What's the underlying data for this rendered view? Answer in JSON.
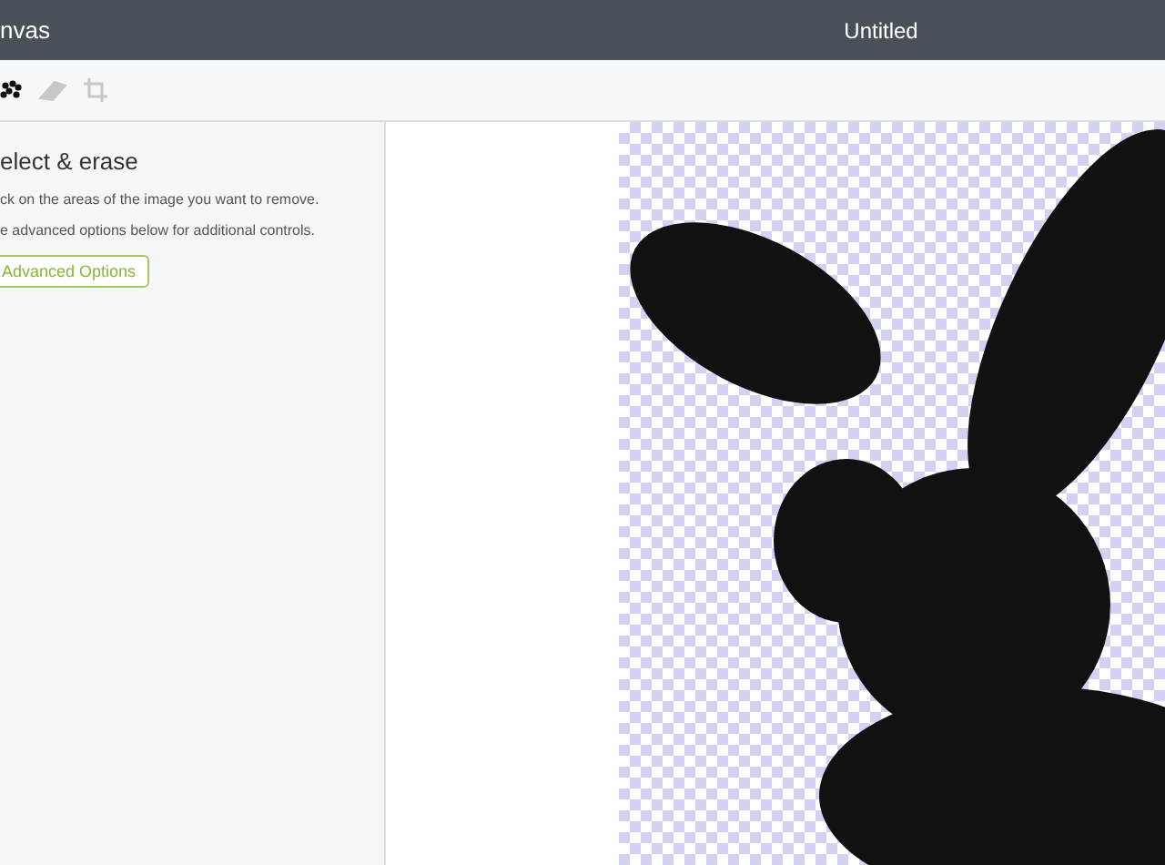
{
  "window": {
    "app_title": "nvas",
    "title": "Untitled"
  },
  "toolbar": {
    "tools": [
      {
        "kind": "magic",
        "selected": true
      },
      {
        "kind": "eraser",
        "selected": false
      },
      {
        "kind": "crop",
        "selected": false
      }
    ]
  },
  "panel": {
    "heading": "elect & erase",
    "lines": [
      "ck on the areas of the image you want to remove.",
      "e advanced options below for additional controls."
    ],
    "button": "Advanced Options"
  }
}
